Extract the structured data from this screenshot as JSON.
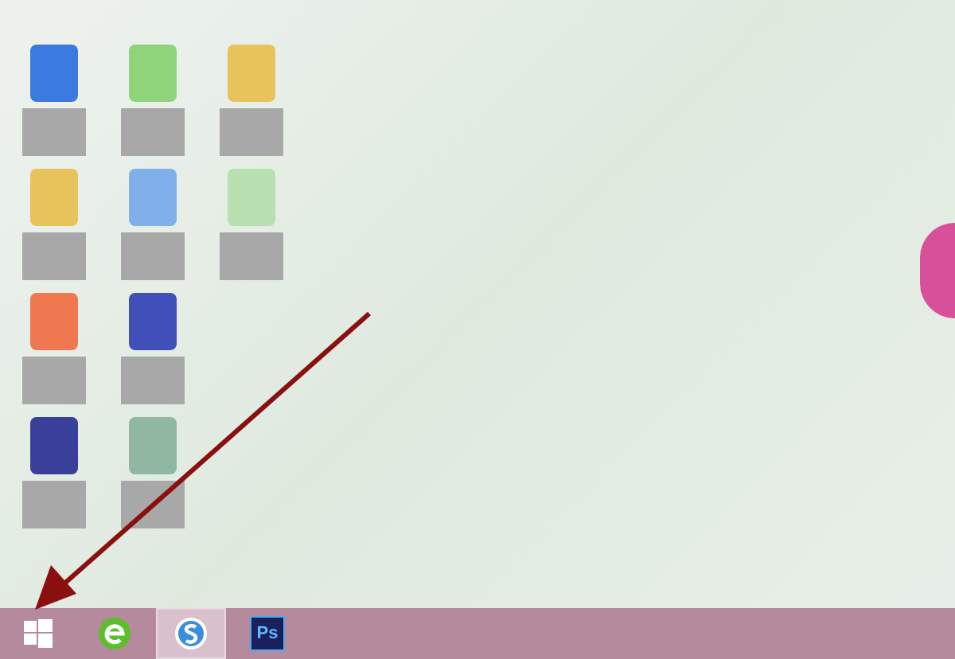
{
  "desktop": {
    "icons": [
      {
        "kind": "document"
      },
      {
        "kind": "spreadsheet"
      },
      {
        "kind": "folder"
      },
      {
        "kind": "folder"
      },
      {
        "kind": "app"
      },
      {
        "kind": "sheet"
      },
      {
        "kind": "presentation"
      },
      {
        "kind": "shortcut"
      },
      {
        "kind": "none"
      },
      {
        "kind": "photoshop"
      },
      {
        "kind": "media"
      },
      {
        "kind": "none"
      }
    ]
  },
  "taskbar": {
    "items": [
      {
        "kind": "start",
        "selected": false
      },
      {
        "kind": "browser",
        "selected": false
      },
      {
        "kind": "input",
        "selected": true
      },
      {
        "kind": "ps",
        "label": "Ps",
        "selected": false
      }
    ]
  }
}
